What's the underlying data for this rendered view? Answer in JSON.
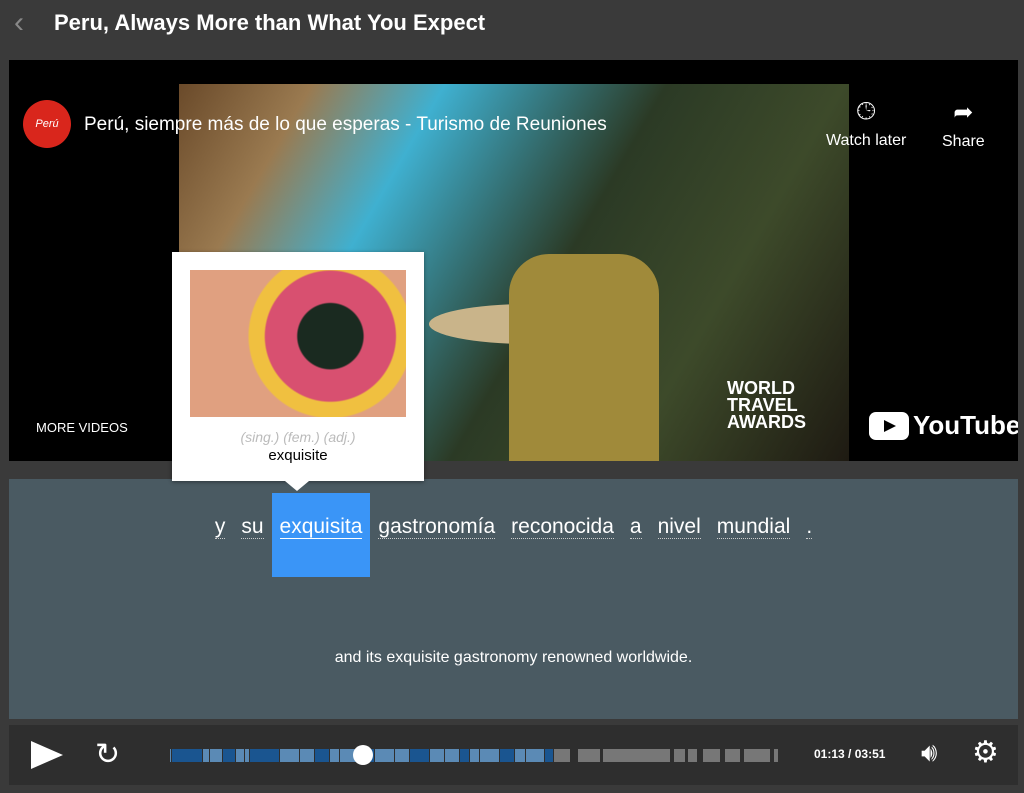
{
  "header": {
    "title": "Peru, Always More than What You Expect",
    "back_icon": "chevron-left"
  },
  "video": {
    "channel_logo": "Perú",
    "title": "Perú, siempre más de lo que esperas - Turismo de Reuniones",
    "watch_later": "Watch later",
    "share": "Share",
    "more_videos": "MORE VIDEOS",
    "award": [
      "WORLD",
      "TRAVEL",
      "AWARDS"
    ],
    "youtube": "YouTube"
  },
  "popup": {
    "pos": "(sing.) (fem.) (adj.)",
    "translation": "exquisite"
  },
  "subtitle": {
    "words": [
      "y",
      "su",
      "exquisita",
      "gastronomía",
      "reconocida",
      "a",
      "nivel",
      "mundial",
      "."
    ],
    "selected_index": 2,
    "translation": "and its exquisite gastronomy renowned worldwide."
  },
  "controls": {
    "current": "01:13",
    "separator": "/",
    "duration": "03:51",
    "progress": 0.316,
    "buffered": 0.63,
    "colors": {
      "played": "#5b8ab5",
      "played_dark": "#1a5590",
      "unplayed": "#777777"
    }
  }
}
